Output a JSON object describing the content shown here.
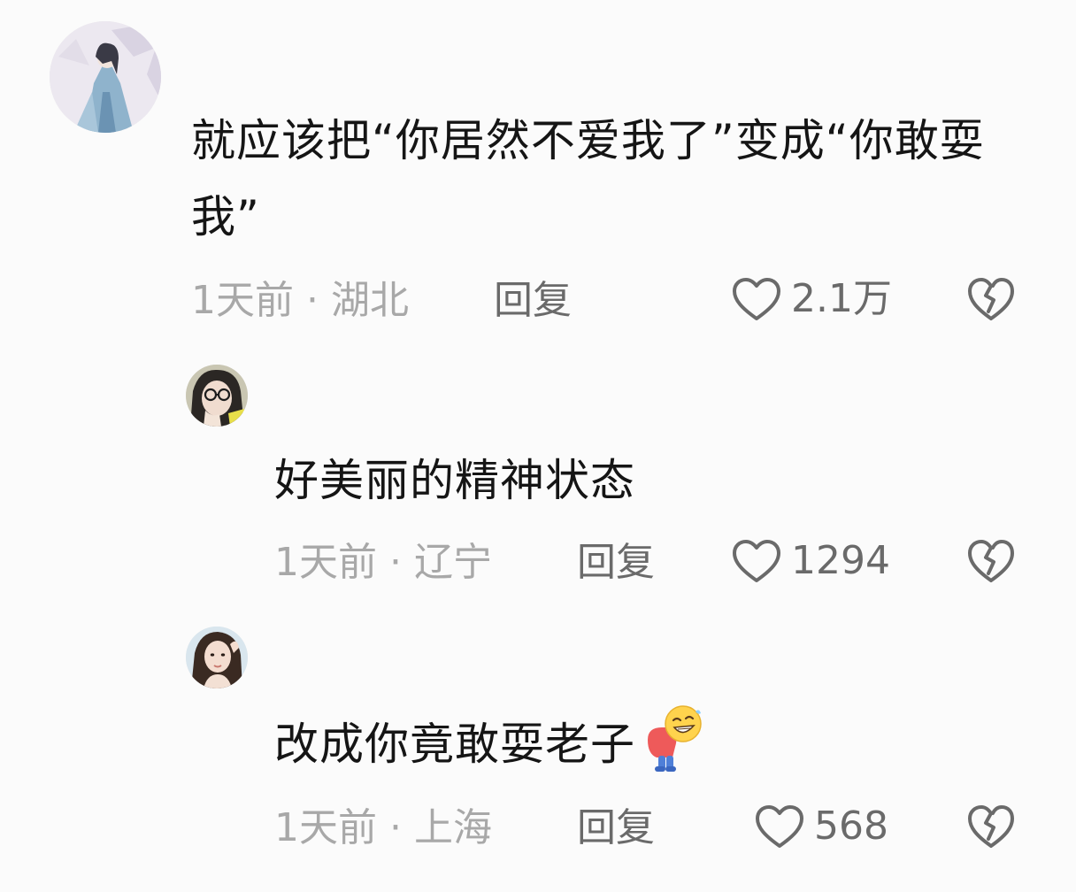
{
  "comments": [
    {
      "text": "就应该把“你居然不爱我了”变成“你敢耍我”",
      "time": "1天前",
      "location": "湖北",
      "reply_label": "回复",
      "likes": "2.1万"
    },
    {
      "text": "好美丽的精神状态",
      "time": "1天前",
      "location": "辽宁",
      "reply_label": "回复",
      "likes": "1294"
    },
    {
      "text": "改成你竟敢耍老子",
      "time": "1天前",
      "location": "上海",
      "reply_label": "回复",
      "likes": "568"
    }
  ],
  "separator": "·",
  "icons": {
    "like": "heart-outline-icon",
    "dislike": "broken-heart-icon",
    "emoji": "bowing-grin-emoji"
  },
  "colors": {
    "background": "#fbfbfb",
    "text": "#151515",
    "meta": "#a8a8a8",
    "action": "#6a6a6a"
  }
}
